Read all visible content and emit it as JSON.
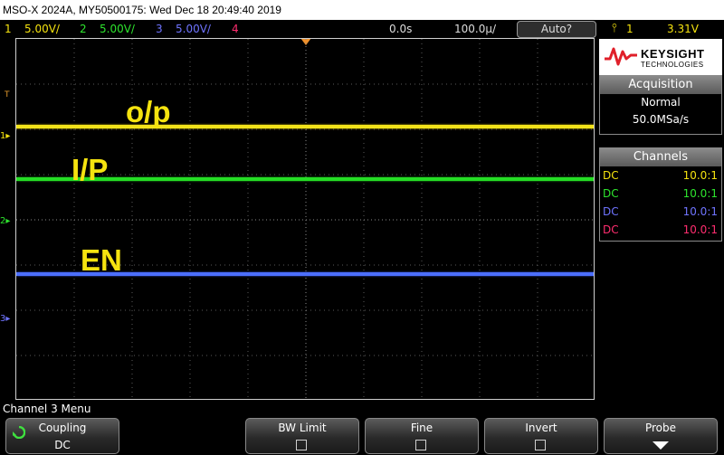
{
  "title": "MSO-X 2024A, MY50500175: Wed Dec 18 20:49:40 2019",
  "status": {
    "channels": [
      {
        "num": "1",
        "scale": "5.00V/",
        "color": "#f5e30f"
      },
      {
        "num": "2",
        "scale": "5.00V/",
        "color": "#2ee52e"
      },
      {
        "num": "3",
        "scale": "5.00V/",
        "color": "#6f74ff"
      },
      {
        "num": "4",
        "scale": "",
        "color": "#ff2d6f"
      }
    ],
    "time_delay": "0.0s",
    "timebase": "100.0µ/",
    "mode": "Auto?",
    "trigger_source": "1",
    "trigger_level": "3.31V"
  },
  "traces": [
    {
      "name": "yellow",
      "color": "#f2e21a",
      "annotation": "o/p"
    },
    {
      "name": "green",
      "color": "#25dd25",
      "annotation": "I/P"
    },
    {
      "name": "blue",
      "color": "#4c6fff",
      "annotation": "EN"
    }
  ],
  "markers": {
    "trigger": "T",
    "ch1": "1",
    "ch2": "2",
    "ch3": "3"
  },
  "brand": {
    "name": "KEYSIGHT",
    "sub": "TECHNOLOGIES"
  },
  "acquisition": {
    "header": "Acquisition",
    "mode": "Normal",
    "rate": "50.0MSa/s"
  },
  "channels_panel": {
    "header": "Channels",
    "rows": [
      {
        "coupling": "DC",
        "probe": "10.0:1",
        "color": "#f5e30f"
      },
      {
        "coupling": "DC",
        "probe": "10.0:1",
        "color": "#2ee52e"
      },
      {
        "coupling": "DC",
        "probe": "10.0:1",
        "color": "#6f74ff"
      },
      {
        "coupling": "DC",
        "probe": "10.0:1",
        "color": "#ff2d6f"
      }
    ]
  },
  "menu": {
    "title": "Channel 3 Menu",
    "coupling_label": "Coupling",
    "coupling_value": "DC",
    "bw_limit_label": "BW Limit",
    "fine_label": "Fine",
    "invert_label": "Invert",
    "probe_label": "Probe"
  }
}
